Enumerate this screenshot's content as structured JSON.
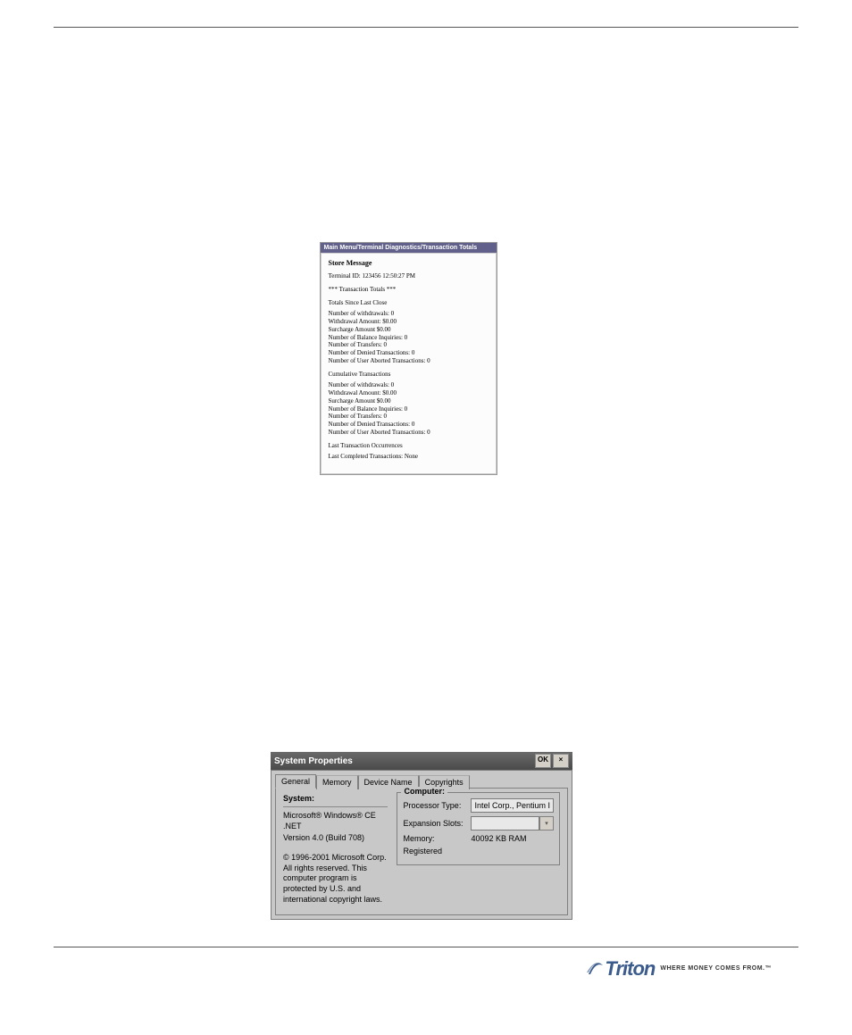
{
  "storeWindow": {
    "title": "Main Menu/Terminal Diagnostics/Transaction Totals",
    "heading": "Store Message",
    "terminalLine": "Terminal ID: 123456 12:50:27 PM",
    "totalsHeader": "*** Transaction Totals ***",
    "sect1Title": "Totals Since Last Close",
    "sect1": [
      "Number of withdrawals:  0",
      "Withdrawal Amount: $0.00",
      "Surcharge Amount $0.00",
      "Number of Balance Inquiries: 0",
      "Number of Transfers: 0",
      "Number of Denied Transactions: 0",
      "Number of User Aborted Transactions: 0"
    ],
    "sect2Title": "Cumulative Transactions",
    "sect2": [
      "Number of withdrawals:  0",
      "Withdrawal Amount: $0.00",
      "Surcharge Amount $0.00",
      "Number of Balance Inquiries: 0",
      "Number of Transfers: 0",
      "Number of Denied Transactions: 0",
      "Number of User Aborted Transactions: 0"
    ],
    "sect3Title": "Last Transaction Occurrences",
    "sect3Line": "Last Completed Transactions: None"
  },
  "sysProps": {
    "title": "System Properties",
    "okLabel": "OK",
    "closeLabel": "×",
    "tabs": {
      "t0": "General",
      "t1": "Memory",
      "t2": "Device Name",
      "t3": "Copyrights"
    },
    "systemLabel": "System:",
    "systemOs": "Microsoft® Windows® CE .NET",
    "systemVer": "Version 4.0 (Build 708)",
    "copyright": "© 1996-2001 Microsoft Corp. All rights reserved. This computer program is protected by U.S. and international copyright laws.",
    "computerLabel": "Computer:",
    "procLabel": "Processor Type:",
    "procValue": "Intel Corp., Pentium I",
    "slotsLabel": "Expansion Slots:",
    "slotsValue": "",
    "memLabel": "Memory:",
    "memValue": "40092 KB  RAM",
    "regLabel": "Registered"
  },
  "logo": {
    "brand": "Triton",
    "tag": "WHERE MONEY COMES FROM.™"
  }
}
